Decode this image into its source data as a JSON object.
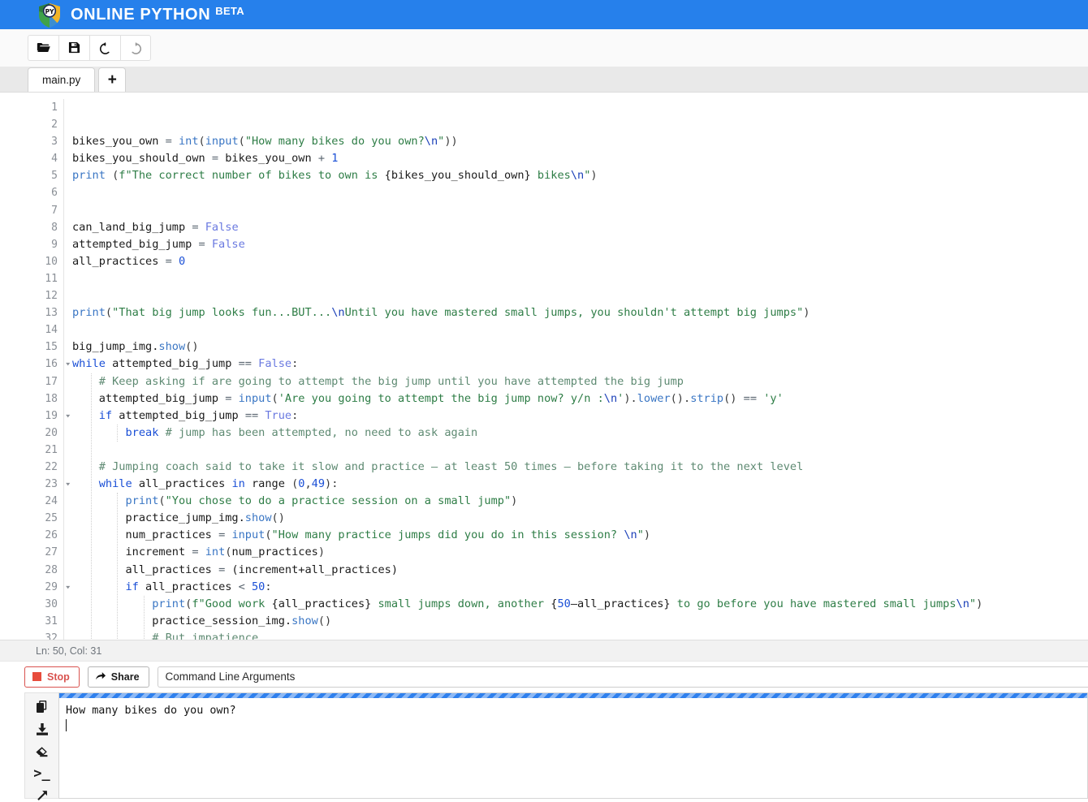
{
  "header": {
    "title": "ONLINE PYTHON",
    "badge": "BETA",
    "logo_text": "PY",
    "brand_color": "#2680eb"
  },
  "toolbar": {
    "buttons": [
      {
        "name": "open-file-button",
        "icon": "folder-open-icon",
        "title": "Open"
      },
      {
        "name": "save-file-button",
        "icon": "save-icon",
        "title": "Save"
      },
      {
        "name": "undo-button",
        "icon": "undo-icon",
        "title": "Undo"
      },
      {
        "name": "redo-button",
        "icon": "redo-icon",
        "title": "Redo"
      }
    ]
  },
  "tabs": {
    "items": [
      {
        "label": "main.py",
        "active": true
      }
    ],
    "add_label": "+"
  },
  "editor": {
    "status": "Ln: 50,  Col: 31",
    "first_line": 1,
    "lines": [
      {
        "n": 1,
        "fold": false,
        "indent": 0,
        "tokens": []
      },
      {
        "n": 2,
        "fold": false,
        "indent": 0,
        "tokens": []
      },
      {
        "n": 3,
        "fold": false,
        "indent": 0,
        "tokens": [
          {
            "t": "def",
            "v": "bikes_you_own "
          },
          {
            "t": "op",
            "v": "="
          },
          {
            "t": "def",
            "v": " "
          },
          {
            "t": "bi",
            "v": "int"
          },
          {
            "t": "punc",
            "v": "("
          },
          {
            "t": "bi",
            "v": "input"
          },
          {
            "t": "punc",
            "v": "("
          },
          {
            "t": "str",
            "v": "\"How many bikes do you own?"
          },
          {
            "t": "esc",
            "v": "\\n"
          },
          {
            "t": "str",
            "v": "\""
          },
          {
            "t": "punc",
            "v": "))"
          }
        ]
      },
      {
        "n": 4,
        "fold": false,
        "indent": 0,
        "tokens": [
          {
            "t": "def",
            "v": "bikes_you_should_own "
          },
          {
            "t": "op",
            "v": "="
          },
          {
            "t": "def",
            "v": " bikes_you_own "
          },
          {
            "t": "op",
            "v": "+"
          },
          {
            "t": "def",
            "v": " "
          },
          {
            "t": "num",
            "v": "1"
          }
        ]
      },
      {
        "n": 5,
        "fold": false,
        "indent": 0,
        "tokens": [
          {
            "t": "bi",
            "v": "print"
          },
          {
            "t": "def",
            "v": " "
          },
          {
            "t": "punc",
            "v": "("
          },
          {
            "t": "str",
            "v": "f\"The correct number of bikes to own is "
          },
          {
            "t": "def",
            "v": "{bikes_you_should_own}"
          },
          {
            "t": "str",
            "v": " bikes"
          },
          {
            "t": "esc",
            "v": "\\n"
          },
          {
            "t": "str",
            "v": "\""
          },
          {
            "t": "punc",
            "v": ")"
          }
        ]
      },
      {
        "n": 6,
        "fold": false,
        "indent": 0,
        "tokens": []
      },
      {
        "n": 7,
        "fold": false,
        "indent": 0,
        "tokens": []
      },
      {
        "n": 8,
        "fold": false,
        "indent": 0,
        "tokens": [
          {
            "t": "def",
            "v": "can_land_big_jump "
          },
          {
            "t": "op",
            "v": "="
          },
          {
            "t": "def",
            "v": " "
          },
          {
            "t": "const",
            "v": "False"
          }
        ]
      },
      {
        "n": 9,
        "fold": false,
        "indent": 0,
        "tokens": [
          {
            "t": "def",
            "v": "attempted_big_jump "
          },
          {
            "t": "op",
            "v": "="
          },
          {
            "t": "def",
            "v": " "
          },
          {
            "t": "const",
            "v": "False"
          }
        ]
      },
      {
        "n": 10,
        "fold": false,
        "indent": 0,
        "tokens": [
          {
            "t": "def",
            "v": "all_practices "
          },
          {
            "t": "op",
            "v": "="
          },
          {
            "t": "def",
            "v": " "
          },
          {
            "t": "num",
            "v": "0"
          }
        ]
      },
      {
        "n": 11,
        "fold": false,
        "indent": 0,
        "tokens": []
      },
      {
        "n": 12,
        "fold": false,
        "indent": 0,
        "tokens": []
      },
      {
        "n": 13,
        "fold": false,
        "indent": 0,
        "tokens": [
          {
            "t": "bi",
            "v": "print"
          },
          {
            "t": "punc",
            "v": "("
          },
          {
            "t": "str",
            "v": "\"That big jump looks fun...BUT..."
          },
          {
            "t": "esc",
            "v": "\\n"
          },
          {
            "t": "str",
            "v": "Until you have mastered small jumps, you shouldn't attempt big jumps\""
          },
          {
            "t": "punc",
            "v": ")"
          }
        ]
      },
      {
        "n": 14,
        "fold": false,
        "indent": 0,
        "tokens": []
      },
      {
        "n": 15,
        "fold": false,
        "indent": 0,
        "tokens": [
          {
            "t": "def",
            "v": "big_jump_img."
          },
          {
            "t": "bi",
            "v": "show"
          },
          {
            "t": "punc",
            "v": "()"
          }
        ]
      },
      {
        "n": 16,
        "fold": true,
        "indent": 0,
        "tokens": [
          {
            "t": "kw",
            "v": "while"
          },
          {
            "t": "def",
            "v": " attempted_big_jump "
          },
          {
            "t": "op",
            "v": "=="
          },
          {
            "t": "def",
            "v": " "
          },
          {
            "t": "const",
            "v": "False"
          },
          {
            "t": "punc",
            "v": ":"
          }
        ]
      },
      {
        "n": 17,
        "fold": false,
        "indent": 1,
        "tokens": [
          {
            "t": "com",
            "v": "    # Keep asking if are going to attempt the big jump until you have attempted the big jump"
          }
        ]
      },
      {
        "n": 18,
        "fold": false,
        "indent": 1,
        "tokens": [
          {
            "t": "def",
            "v": "    attempted_big_jump "
          },
          {
            "t": "op",
            "v": "="
          },
          {
            "t": "def",
            "v": " "
          },
          {
            "t": "bi",
            "v": "input"
          },
          {
            "t": "punc",
            "v": "("
          },
          {
            "t": "str",
            "v": "'Are you going to attempt the big jump now? y/n :"
          },
          {
            "t": "esc",
            "v": "\\n"
          },
          {
            "t": "str",
            "v": "'"
          },
          {
            "t": "punc",
            "v": ")."
          },
          {
            "t": "bi",
            "v": "lower"
          },
          {
            "t": "punc",
            "v": "()."
          },
          {
            "t": "bi",
            "v": "strip"
          },
          {
            "t": "punc",
            "v": "()"
          },
          {
            "t": "def",
            "v": " "
          },
          {
            "t": "op",
            "v": "=="
          },
          {
            "t": "def",
            "v": " "
          },
          {
            "t": "str",
            "v": "'y'"
          }
        ]
      },
      {
        "n": 19,
        "fold": true,
        "indent": 1,
        "tokens": [
          {
            "t": "def",
            "v": "    "
          },
          {
            "t": "kw",
            "v": "if"
          },
          {
            "t": "def",
            "v": " attempted_big_jump "
          },
          {
            "t": "op",
            "v": "=="
          },
          {
            "t": "def",
            "v": " "
          },
          {
            "t": "const",
            "v": "True"
          },
          {
            "t": "punc",
            "v": ":"
          }
        ]
      },
      {
        "n": 20,
        "fold": false,
        "indent": 2,
        "tokens": [
          {
            "t": "def",
            "v": "        "
          },
          {
            "t": "kw",
            "v": "break"
          },
          {
            "t": "com",
            "v": " # jump has been attempted, no need to ask again"
          }
        ]
      },
      {
        "n": 21,
        "fold": false,
        "indent": 1,
        "tokens": []
      },
      {
        "n": 22,
        "fold": false,
        "indent": 1,
        "tokens": [
          {
            "t": "com",
            "v": "    # Jumping coach said to take it slow and practice – at least 50 times – before taking it to the next level"
          }
        ]
      },
      {
        "n": 23,
        "fold": true,
        "indent": 1,
        "tokens": [
          {
            "t": "def",
            "v": "    "
          },
          {
            "t": "kw",
            "v": "while"
          },
          {
            "t": "def",
            "v": " all_practices "
          },
          {
            "t": "kw",
            "v": "in"
          },
          {
            "t": "def",
            "v": " range "
          },
          {
            "t": "punc",
            "v": "("
          },
          {
            "t": "num",
            "v": "0"
          },
          {
            "t": "punc",
            "v": ","
          },
          {
            "t": "num",
            "v": "49"
          },
          {
            "t": "punc",
            "v": "):"
          }
        ]
      },
      {
        "n": 24,
        "fold": false,
        "indent": 2,
        "tokens": [
          {
            "t": "def",
            "v": "        "
          },
          {
            "t": "bi",
            "v": "print"
          },
          {
            "t": "punc",
            "v": "("
          },
          {
            "t": "str",
            "v": "\"You chose to do a practice session on a small jump\""
          },
          {
            "t": "punc",
            "v": ")"
          }
        ]
      },
      {
        "n": 25,
        "fold": false,
        "indent": 2,
        "tokens": [
          {
            "t": "def",
            "v": "        practice_jump_img."
          },
          {
            "t": "bi",
            "v": "show"
          },
          {
            "t": "punc",
            "v": "()"
          }
        ]
      },
      {
        "n": 26,
        "fold": false,
        "indent": 2,
        "tokens": [
          {
            "t": "def",
            "v": "        num_practices "
          },
          {
            "t": "op",
            "v": "="
          },
          {
            "t": "def",
            "v": " "
          },
          {
            "t": "bi",
            "v": "input"
          },
          {
            "t": "punc",
            "v": "("
          },
          {
            "t": "str",
            "v": "\"How many practice jumps did you do in this session? "
          },
          {
            "t": "esc",
            "v": "\\n"
          },
          {
            "t": "str",
            "v": "\""
          },
          {
            "t": "punc",
            "v": ")"
          }
        ]
      },
      {
        "n": 27,
        "fold": false,
        "indent": 2,
        "tokens": [
          {
            "t": "def",
            "v": "        increment "
          },
          {
            "t": "op",
            "v": "="
          },
          {
            "t": "def",
            "v": " "
          },
          {
            "t": "bi",
            "v": "int"
          },
          {
            "t": "punc",
            "v": "("
          },
          {
            "t": "def",
            "v": "num_practices"
          },
          {
            "t": "punc",
            "v": ")"
          }
        ]
      },
      {
        "n": 28,
        "fold": false,
        "indent": 2,
        "tokens": [
          {
            "t": "def",
            "v": "        all_practices "
          },
          {
            "t": "op",
            "v": "="
          },
          {
            "t": "def",
            "v": " (increment+all_practices)"
          }
        ]
      },
      {
        "n": 29,
        "fold": true,
        "indent": 2,
        "tokens": [
          {
            "t": "def",
            "v": "        "
          },
          {
            "t": "kw",
            "v": "if"
          },
          {
            "t": "def",
            "v": " all_practices "
          },
          {
            "t": "op",
            "v": "<"
          },
          {
            "t": "def",
            "v": " "
          },
          {
            "t": "num",
            "v": "50"
          },
          {
            "t": "punc",
            "v": ":"
          }
        ]
      },
      {
        "n": 30,
        "fold": false,
        "indent": 3,
        "tokens": [
          {
            "t": "def",
            "v": "            "
          },
          {
            "t": "bi",
            "v": "print"
          },
          {
            "t": "punc",
            "v": "("
          },
          {
            "t": "str",
            "v": "f\"Good work "
          },
          {
            "t": "def",
            "v": "{all_practices}"
          },
          {
            "t": "str",
            "v": " small jumps down, another "
          },
          {
            "t": "def",
            "v": "{"
          },
          {
            "t": "num",
            "v": "50"
          },
          {
            "t": "def",
            "v": "–all_practices}"
          },
          {
            "t": "str",
            "v": " to go before you have mastered small jumps"
          },
          {
            "t": "esc",
            "v": "\\n"
          },
          {
            "t": "str",
            "v": "\""
          },
          {
            "t": "punc",
            "v": ")"
          }
        ]
      },
      {
        "n": 31,
        "fold": false,
        "indent": 3,
        "tokens": [
          {
            "t": "def",
            "v": "            practice_session_img."
          },
          {
            "t": "bi",
            "v": "show"
          },
          {
            "t": "punc",
            "v": "()"
          }
        ]
      },
      {
        "n": 32,
        "fold": false,
        "indent": 3,
        "tokens": [
          {
            "t": "com",
            "v": "            # But impatience..."
          }
        ]
      }
    ]
  },
  "runbar": {
    "stop_label": "Stop",
    "share_label": "Share",
    "cla_placeholder": "Command Line Arguments",
    "cla_value": "",
    "stop_color": "#d9534f"
  },
  "output": {
    "rail_icons": [
      {
        "name": "copy-icon",
        "title": "Copy output"
      },
      {
        "name": "download-icon",
        "title": "Download output"
      },
      {
        "name": "clear-icon",
        "title": "Clear output"
      },
      {
        "name": "terminal-icon",
        "title": "Terminal",
        "glyph": ">_"
      },
      {
        "name": "expand-icon",
        "title": "Expand"
      }
    ],
    "running": true,
    "text": "How many bikes do you own?"
  }
}
